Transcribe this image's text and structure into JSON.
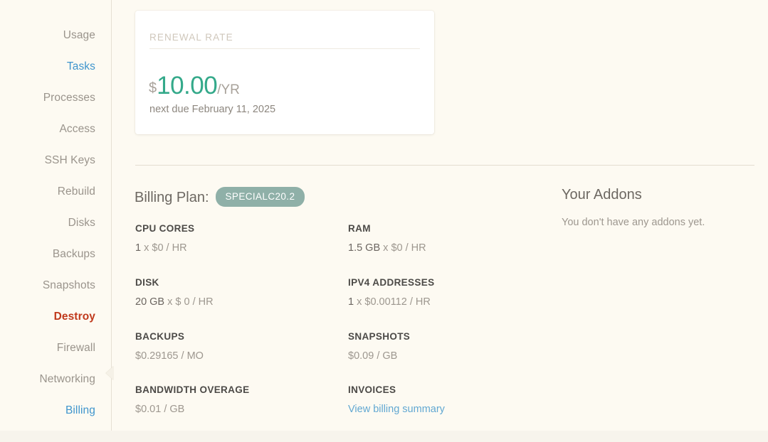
{
  "sidebar": {
    "items": [
      {
        "label": "Usage",
        "state": "default"
      },
      {
        "label": "Tasks",
        "state": "active"
      },
      {
        "label": "Processes",
        "state": "default"
      },
      {
        "label": "Access",
        "state": "default"
      },
      {
        "label": "SSH Keys",
        "state": "default"
      },
      {
        "label": "Rebuild",
        "state": "default"
      },
      {
        "label": "Disks",
        "state": "default"
      },
      {
        "label": "Backups",
        "state": "default"
      },
      {
        "label": "Snapshots",
        "state": "default"
      },
      {
        "label": "Destroy",
        "state": "danger"
      },
      {
        "label": "Firewall",
        "state": "default"
      },
      {
        "label": "Networking",
        "state": "default"
      },
      {
        "label": "Billing",
        "state": "active"
      }
    ],
    "collapse_icon": "chevron-left-icon"
  },
  "renewal_card": {
    "label": "RENEWAL RATE",
    "currency": "$",
    "amount": "10.00",
    "period": "/YR",
    "due_text": "next due February 11, 2025"
  },
  "billing_plan": {
    "heading": "Billing Plan:",
    "badge": "SPECIALC20.2"
  },
  "specs": {
    "cpu_cores": {
      "label": "CPU CORES",
      "num": "1",
      "rest": " x $0 / HR"
    },
    "ram": {
      "label": "RAM",
      "num": "1.5 GB",
      "rest": " x $0 / HR"
    },
    "disk": {
      "label": "DISK",
      "num": "20 GB",
      "rest": " x $ 0 / HR"
    },
    "ipv4_addresses": {
      "label": "IPV4 ADDRESSES",
      "num": "1",
      "rest": " x $0.00112 / HR"
    },
    "backups": {
      "label": "BACKUPS",
      "num": "",
      "rest": "$0.29165 / MO"
    },
    "snapshots": {
      "label": "SNAPSHOTS",
      "num": "",
      "rest": "$0.09 / GB"
    },
    "bandwidth_overage": {
      "label": "BANDWIDTH OVERAGE",
      "num": "",
      "rest": "$0.01 / GB"
    },
    "invoices": {
      "label": "INVOICES",
      "link": "View billing summary"
    }
  },
  "addons": {
    "title": "Your Addons",
    "empty_text": "You don't have any addons yet."
  },
  "colors": {
    "background": "#fdfaf2",
    "accent_blue": "#3f95cd",
    "danger_red": "#c0391c",
    "teal": "#34a98a",
    "badge": "#8fb0a8",
    "link": "#62a8d2"
  }
}
